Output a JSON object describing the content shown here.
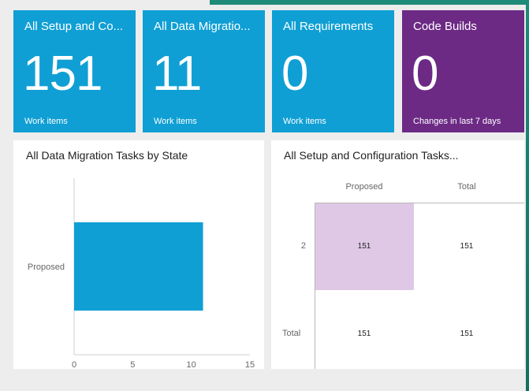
{
  "tiles": [
    {
      "title": "All Setup and Co...",
      "value": "151",
      "subtitle": "Work items",
      "color": "#0f9fd4"
    },
    {
      "title": "All Data Migratio...",
      "value": "11",
      "subtitle": "Work items",
      "color": "#0f9fd4"
    },
    {
      "title": "All Requirements",
      "value": "0",
      "subtitle": "Work items",
      "color": "#0f9fd4"
    },
    {
      "title": "Code Builds",
      "value": "0",
      "subtitle": "Changes in last 7 days",
      "color": "#6c2a85"
    }
  ],
  "bar_panel": {
    "title": "All Data Migration Tasks by State"
  },
  "pivot_panel": {
    "title": "All Setup and Configuration Tasks...",
    "col_headers": [
      "Proposed",
      "Total"
    ],
    "rows": [
      {
        "label": "2",
        "cells": [
          "151",
          "151"
        ]
      },
      {
        "label": "Total",
        "cells": [
          "151",
          "151"
        ]
      }
    ],
    "highlight_color": "#dfc8e6"
  },
  "chart_data": {
    "type": "bar",
    "orientation": "horizontal",
    "categories": [
      "Proposed"
    ],
    "values": [
      11
    ],
    "xlim": [
      0,
      15
    ],
    "xticks": [
      0,
      5,
      10,
      15
    ],
    "bar_color": "#0f9fd4",
    "title": "All Data Migration Tasks by State"
  }
}
